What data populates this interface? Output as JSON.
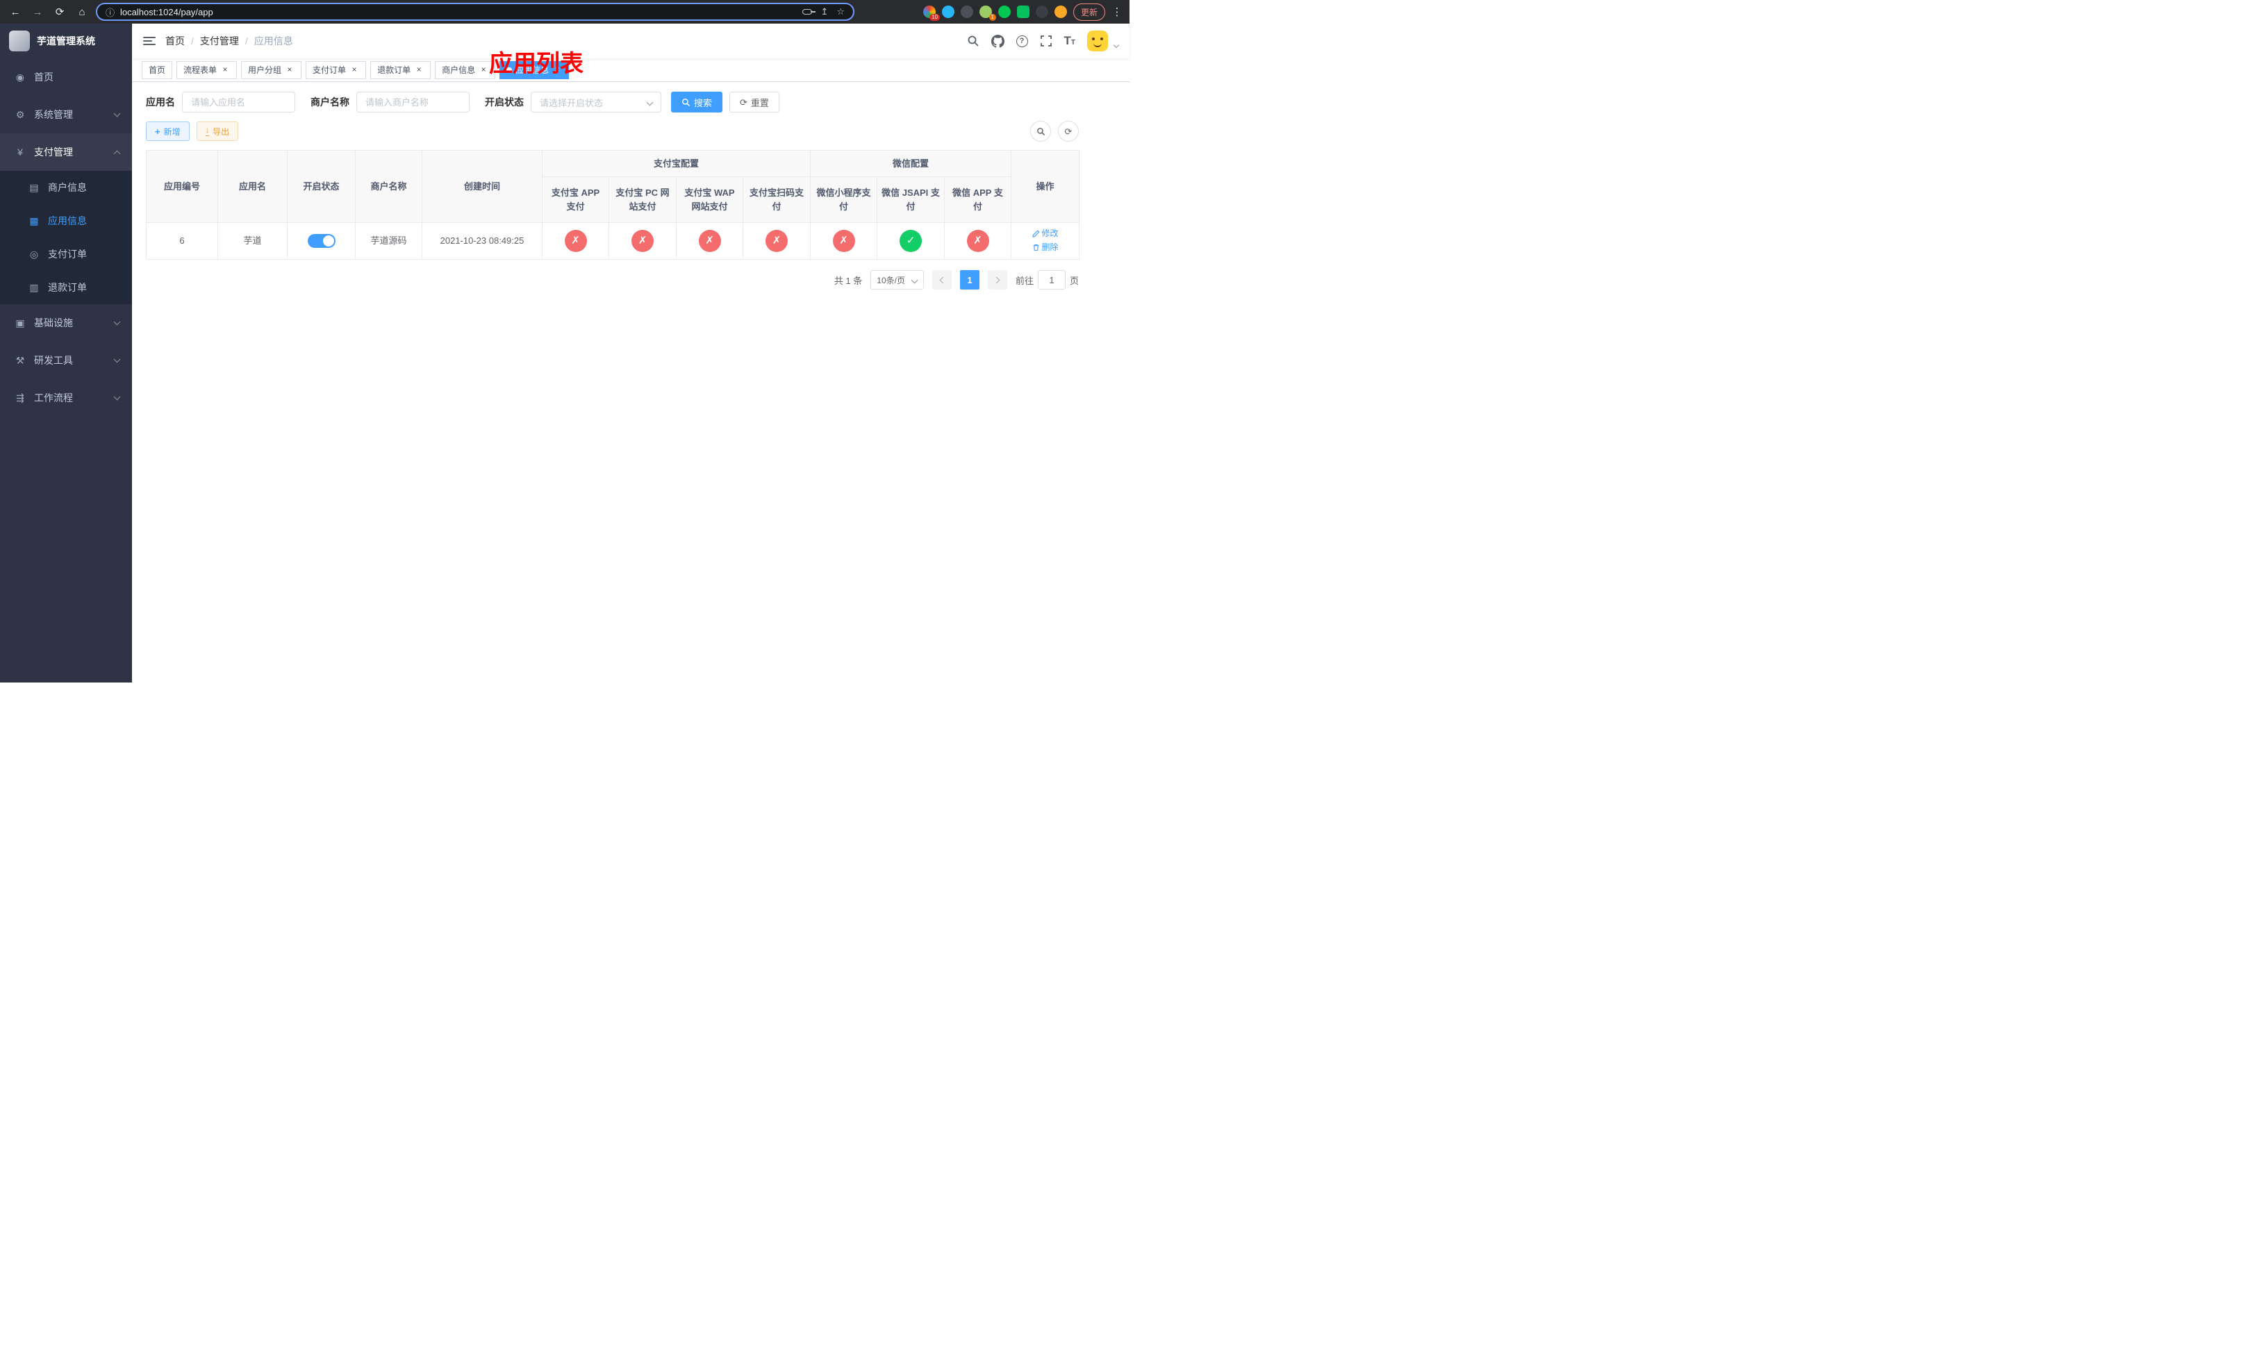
{
  "browser": {
    "url": "localhost:1024/pay/app",
    "update_label": "更新",
    "ext_badge_count": "10",
    "ext_badge_count2": "1"
  },
  "icons": {
    "check": "✓",
    "close": "✗",
    "back": "←",
    "forward": "→",
    "reload": "⟳",
    "browser_home": "⌂",
    "info": "ⓘ",
    "share": "↥",
    "star": "☆",
    "kebab": "⋮",
    "home": "◉",
    "gear": "⚙",
    "yen": "¥",
    "merchant": "▤",
    "app": "▦",
    "order": "◎",
    "refund": "▥",
    "infra": "▣",
    "tools": "⚒",
    "flow": "⇶",
    "question": "?",
    "t_big": "T",
    "t_small": "T",
    "plus": "+",
    "download": "↓"
  },
  "sidebar": {
    "title": "芋道管理系统",
    "items": [
      {
        "label": "首页"
      },
      {
        "label": "系统管理"
      },
      {
        "label": "支付管理"
      },
      {
        "label": "基础设施"
      },
      {
        "label": "研发工具"
      },
      {
        "label": "工作流程"
      }
    ],
    "pay_children": [
      {
        "label": "商户信息"
      },
      {
        "label": "应用信息",
        "active": true
      },
      {
        "label": "支付订单"
      },
      {
        "label": "退款订单"
      }
    ]
  },
  "header": {
    "breadcrumb": [
      "首页",
      "支付管理",
      "应用信息"
    ],
    "annotation": "应用列表"
  },
  "tabs": [
    {
      "label": "首页",
      "closable": false
    },
    {
      "label": "流程表单",
      "closable": true
    },
    {
      "label": "用户分组",
      "closable": true
    },
    {
      "label": "支付订单",
      "closable": true
    },
    {
      "label": "退款订单",
      "closable": true
    },
    {
      "label": "商户信息",
      "closable": true
    },
    {
      "label": "应用信息",
      "closable": true,
      "active": true
    }
  ],
  "filters": {
    "app_name": {
      "label": "应用名",
      "placeholder": "请输入应用名",
      "value": ""
    },
    "merchant_name": {
      "label": "商户名称",
      "placeholder": "请输入商户名称",
      "value": ""
    },
    "status": {
      "label": "开启状态",
      "placeholder": "请选择开启状态"
    },
    "search_label": "搜索",
    "reset_label": "重置"
  },
  "toolbar": {
    "add_label": "新增",
    "export_label": "导出"
  },
  "table": {
    "headers": {
      "app_id": "应用编号",
      "app_name": "应用名",
      "status": "开启状态",
      "merchant_name": "商户名称",
      "create_time": "创建时间",
      "alipay_group": "支付宝配置",
      "wechat_group": "微信配置",
      "alipay_app": "支付宝 APP 支付",
      "alipay_pc": "支付宝 PC 网站支付",
      "alipay_wap": "支付宝 WAP 网站支付",
      "alipay_qr": "支付宝扫码支付",
      "wx_mini": "微信小程序支付",
      "wx_jsapi": "微信 JSAPI 支付",
      "wx_app": "微信 APP 支付",
      "actions": "操作"
    },
    "rows": [
      {
        "app_id": "6",
        "app_name": "芋道",
        "status_on": true,
        "merchant_name": "芋道源码",
        "create_time": "2021-10-23 08:49:25",
        "alipay_app": false,
        "alipay_pc": false,
        "alipay_wap": false,
        "alipay_qr": false,
        "wx_mini": false,
        "wx_jsapi": true,
        "wx_app": false,
        "edit_label": "修改",
        "delete_label": "删除"
      }
    ]
  },
  "pagination": {
    "total": "共 1 条",
    "page_size": "10条/页",
    "page": "1",
    "goto_label": "前往",
    "goto_value": "1",
    "unit_label": "页"
  }
}
